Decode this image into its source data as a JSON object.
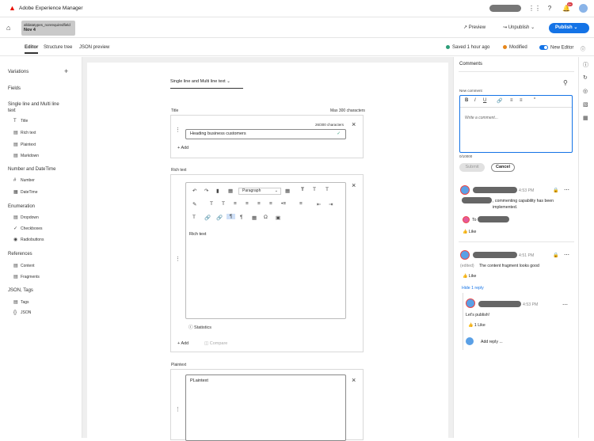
{
  "app": {
    "title": "Adobe Experience Manager",
    "notif_count": "9+"
  },
  "item": {
    "name": "alldatatypes_nonrequiredfield",
    "date": "Nov 4"
  },
  "header": {
    "preview": "Preview",
    "unpublish": "Unpublish",
    "publish": "Publish"
  },
  "tabs": [
    "Editor",
    "Structure tree",
    "JSON preview"
  ],
  "status": {
    "saved": "Saved 1 hour ago",
    "modified": "Modified",
    "new_editor": "New Editor"
  },
  "left": {
    "variations": "Variations",
    "fields": "Fields",
    "groups": [
      {
        "title": "Single line and Multi line text",
        "items": [
          "Title",
          "Rich text",
          "Plaintext",
          "Markdown"
        ]
      },
      {
        "title": "Number and DateTime",
        "items": [
          "Number",
          "DateTime"
        ]
      },
      {
        "title": "Enumeration",
        "items": [
          "Dropdown",
          "Checkboxes",
          "Radiobuttons"
        ]
      },
      {
        "title": "References",
        "items": [
          "Content",
          "Fragments"
        ]
      },
      {
        "title": "JSON, Tags",
        "items": [
          "Tags",
          "JSON"
        ]
      }
    ]
  },
  "editor": {
    "filter": "Single line and Multi line text",
    "title_label": "Title",
    "title_max": "Max 300 characters",
    "title_count": "26/300 characters",
    "title_value": "Heading business customers",
    "add": "Add",
    "rich_label": "Rich text",
    "paragraph": "Paragraph",
    "rich_value": "Rich text",
    "statistics": "Statistics",
    "compare": "Compare",
    "plain_label": "Plaintext",
    "plain_value": "PLaintext"
  },
  "comments": {
    "title": "Comments",
    "new_comment": "New comment",
    "placeholder": "Write a comment...",
    "count": "0/10000",
    "submit": "Submit",
    "cancel": "Cancel",
    "c1_time": "4:53 PM",
    "c1_text": ", commenting capability has been implemented.",
    "c1_to": "To",
    "like": "Like",
    "c2_time": "4:51 PM",
    "c2_edited": "(edited)",
    "c2_text": "The content fragment looks good",
    "hide_reply": "Hide 1 reply",
    "r1_time": "4:53 PM",
    "r1_text": "Let's publish!",
    "r1_likes": "1 Like",
    "add_reply": "Add reply ..."
  }
}
